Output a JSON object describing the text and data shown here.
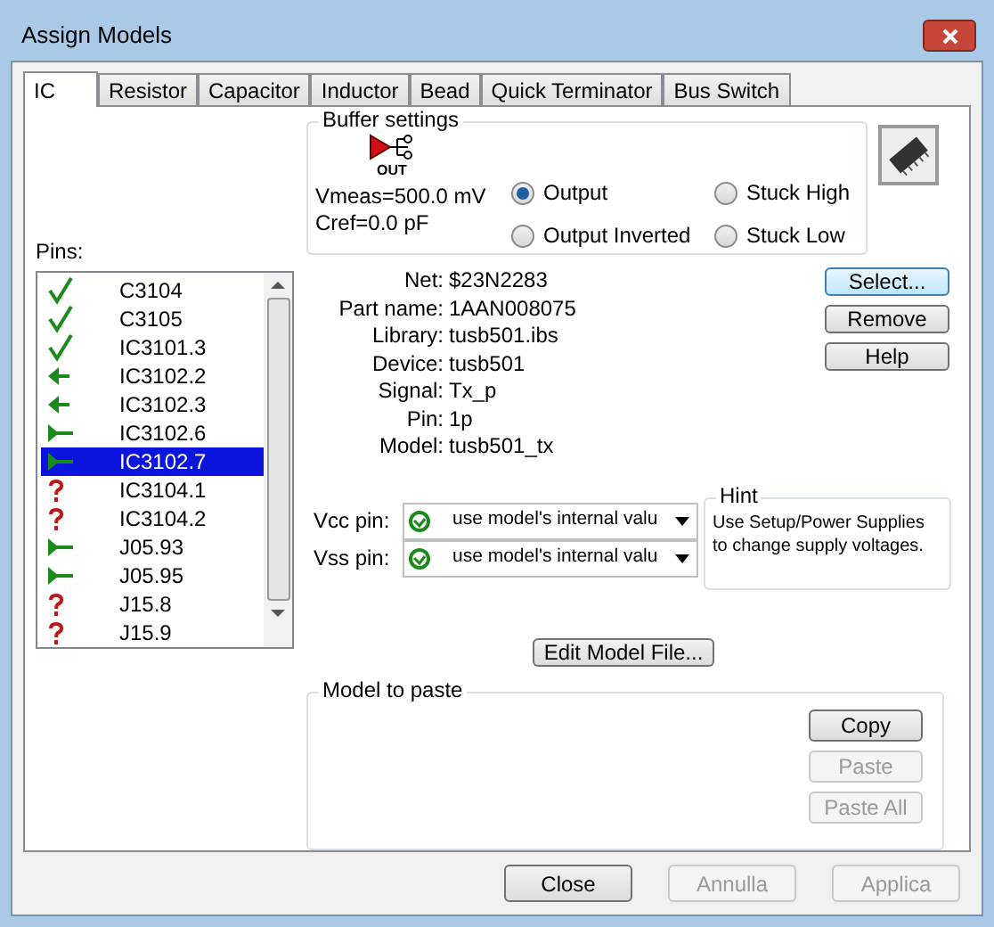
{
  "window": {
    "title": "Assign Models"
  },
  "tabs": [
    {
      "label": "IC",
      "selected": true
    },
    {
      "label": "Resistor",
      "selected": false
    },
    {
      "label": "Capacitor",
      "selected": false
    },
    {
      "label": "Inductor",
      "selected": false
    },
    {
      "label": "Bead",
      "selected": false
    },
    {
      "label": "Quick Terminator",
      "selected": false
    },
    {
      "label": "Bus Switch",
      "selected": false
    }
  ],
  "buffer_settings": {
    "title": "Buffer settings",
    "symbol_label": "OUT",
    "vmeas": "Vmeas=500.0 mV",
    "cref": "Cref=0.0 pF",
    "options": [
      {
        "label": "Output",
        "selected": true
      },
      {
        "label": "Output Inverted",
        "selected": false
      },
      {
        "label": "Stuck High",
        "selected": false
      },
      {
        "label": "Stuck Low",
        "selected": false
      }
    ]
  },
  "pins": {
    "label": "Pins:",
    "items": [
      {
        "name": "C3104",
        "kind": "check",
        "selected": false
      },
      {
        "name": "C3105",
        "kind": "check",
        "selected": false
      },
      {
        "name": "IC3101.3",
        "kind": "check",
        "selected": false
      },
      {
        "name": "IC3102.2",
        "kind": "input",
        "selected": false
      },
      {
        "name": "IC3102.3",
        "kind": "input",
        "selected": false
      },
      {
        "name": "IC3102.6",
        "kind": "output",
        "selected": false
      },
      {
        "name": "IC3102.7",
        "kind": "output",
        "selected": true
      },
      {
        "name": "IC3104.1",
        "kind": "unknown",
        "selected": false
      },
      {
        "name": "IC3104.2",
        "kind": "unknown",
        "selected": false
      },
      {
        "name": "J05.93",
        "kind": "output",
        "selected": false
      },
      {
        "name": "J05.95",
        "kind": "output",
        "selected": false
      },
      {
        "name": "J15.8",
        "kind": "unknown",
        "selected": false
      },
      {
        "name": "J15.9",
        "kind": "unknown",
        "selected": false
      }
    ]
  },
  "info": [
    {
      "label": "Net:",
      "value": "$23N2283"
    },
    {
      "label": "Part name:",
      "value": "1AAN008075"
    },
    {
      "label": "Library:",
      "value": "tusb501.ibs"
    },
    {
      "label": "Device:",
      "value": "tusb501"
    },
    {
      "label": "Signal:",
      "value": "Tx_p"
    },
    {
      "label": "Pin:",
      "value": "1p"
    },
    {
      "label": "Model:",
      "value": "tusb501_tx"
    }
  ],
  "side_buttons": [
    {
      "label": "Select...",
      "disabled": false,
      "default": true
    },
    {
      "label": "Remove",
      "disabled": false,
      "default": false
    },
    {
      "label": "Help",
      "disabled": false,
      "default": false
    }
  ],
  "supply_pins": [
    {
      "label": "Vcc pin:",
      "value": "use model's internal valu"
    },
    {
      "label": "Vss pin:",
      "value": "use model's internal valu"
    }
  ],
  "hint": {
    "title": "Hint",
    "text": "Use Setup/Power Supplies to change supply voltages."
  },
  "edit_button": "Edit Model File...",
  "model_to_paste": {
    "title": "Model to paste",
    "buttons": [
      {
        "label": "Copy",
        "disabled": false
      },
      {
        "label": "Paste",
        "disabled": true
      },
      {
        "label": "Paste All",
        "disabled": true
      }
    ]
  },
  "footer_buttons": [
    {
      "label": "Close",
      "disabled": false
    },
    {
      "label": "Annulla",
      "disabled": true
    },
    {
      "label": "Applica",
      "disabled": true
    }
  ]
}
